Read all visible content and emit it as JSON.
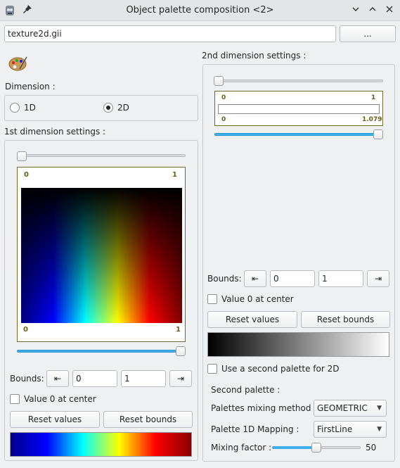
{
  "window": {
    "title": "Object palette composition <2>"
  },
  "file": {
    "value": "texture2d.gii",
    "browse_label": "..."
  },
  "dimension": {
    "label": "Dimension :",
    "option_1d": "1D",
    "option_2d": "2D",
    "selected": "2D"
  },
  "first_dim": {
    "title": "1st dimension settings :",
    "top_min": "0",
    "top_max": "1",
    "bottom_min": "0",
    "bottom_max": "1",
    "slider_top_fraction": 0.0,
    "slider_bottom_fraction": 1.0,
    "bounds_label": "Bounds:",
    "bound_min": "0",
    "bound_max": "1",
    "value0_label": "Value 0 at center",
    "reset_values": "Reset values",
    "reset_bounds": "Reset bounds"
  },
  "second_dim": {
    "title": "2nd dimension settings :",
    "top_min": "0",
    "top_max": "1",
    "bottom_min": "0",
    "bottom_max": "1.079",
    "slider_top_fraction": 0.0,
    "slider_bottom_fraction": 1.0,
    "bounds_label": "Bounds:",
    "bound_min": "0",
    "bound_max": "1",
    "value0_label": "Value 0 at center",
    "reset_values": "Reset values",
    "reset_bounds": "Reset bounds",
    "second_palette_label": "Use a second palette for 2D",
    "second_palette_heading": "Second palette :",
    "mixing_method_label": "Palettes mixing method :",
    "mixing_method_value": "GEOMETRIC",
    "mapping_label": "Palette 1D Mapping :",
    "mapping_value": "FirstLine",
    "mixing_factor_label": "Mixing factor :",
    "mixing_factor_value": "50",
    "mixing_factor_fraction": 0.5
  },
  "icons": {
    "app": "app-icon",
    "pin": "pin-icon",
    "palette": "palette-icon",
    "min_bound": "go-to-start-icon",
    "max_bound": "go-to-end-icon"
  }
}
